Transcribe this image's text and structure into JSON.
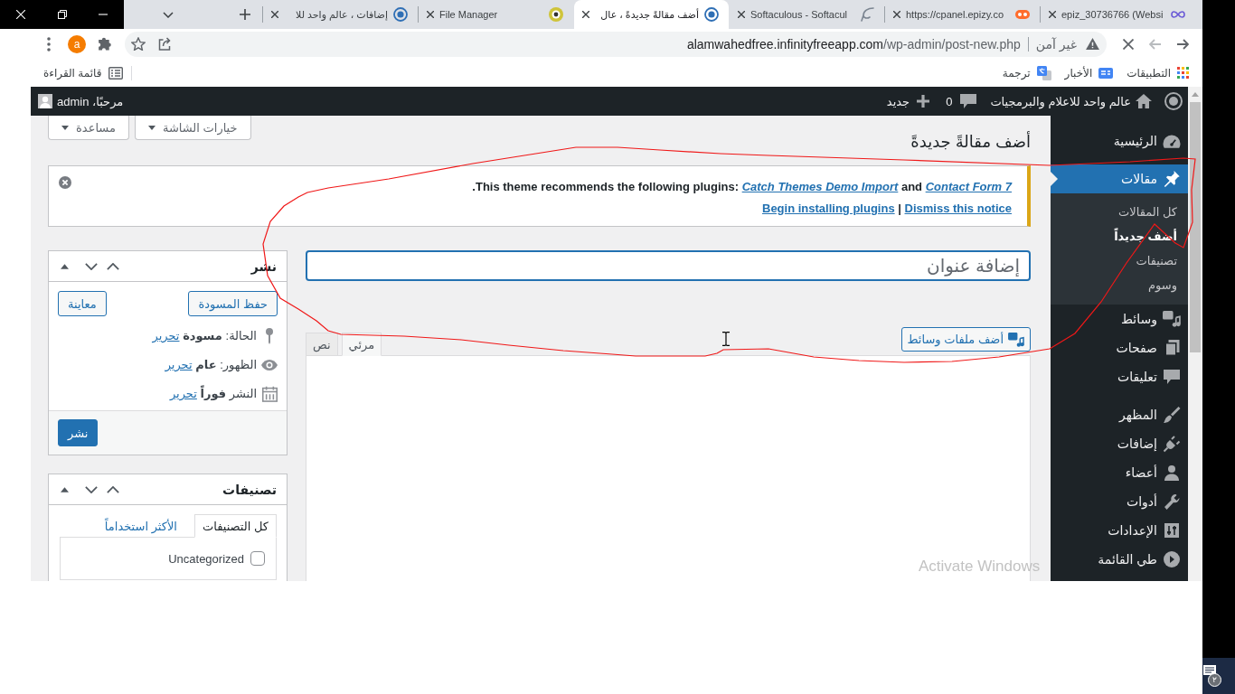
{
  "browser": {
    "tabs": [
      {
        "title": "epiz_30736766 (Websi",
        "selected": false
      },
      {
        "title": "https://cpanel.epizy.co",
        "selected": false
      },
      {
        "title": "Softaculous - Softacul",
        "selected": false
      },
      {
        "title": "أضف مقالةً جديدةً ، عال",
        "selected": true
      },
      {
        "title": "File Manager",
        "selected": false
      },
      {
        "title": "إضافات ، عالم واحد للا",
        "selected": false
      }
    ],
    "address_bar": {
      "security_label": "غير آمن",
      "url_host": "alamwahedfree.infinityfreeapp.com",
      "url_path": "/wp-admin/post-new.php"
    },
    "profile_initial": "a",
    "bookmarks": [
      {
        "label": "التطبيقات"
      },
      {
        "label": "الأخبار"
      },
      {
        "label": "ترجمة"
      }
    ],
    "reading_list": "قائمة القراءة"
  },
  "admin_bar": {
    "site_name": "عالم واحد للاعلام والبرمجيات",
    "comment_count": "0",
    "new_label": "جديد",
    "greeting": "مرحبًا، admin"
  },
  "admin_menu": [
    {
      "items": [
        {
          "label": "الرئيسية",
          "selected": false
        }
      ]
    },
    {
      "items": [
        {
          "label": "مقالات",
          "selected": true,
          "children": [
            {
              "label": "كل المقالات",
              "selected": false
            },
            {
              "label": "أضف جديداً",
              "selected": true
            },
            {
              "label": "تصنيفات",
              "selected": false
            },
            {
              "label": "وسوم",
              "selected": false
            }
          ]
        },
        {
          "label": "وسائط",
          "selected": false
        },
        {
          "label": "صفحات",
          "selected": false
        },
        {
          "label": "تعليقات",
          "selected": false
        }
      ]
    },
    {
      "items": [
        {
          "label": "المظهر",
          "selected": false
        },
        {
          "label": "إضافات",
          "selected": false
        },
        {
          "label": "أعضاء",
          "selected": false
        },
        {
          "label": "أدوات",
          "selected": false
        },
        {
          "label": "الإعدادات",
          "selected": false
        },
        {
          "label": "طي القائمة",
          "selected": false
        }
      ]
    }
  ],
  "screen_meta": [
    {
      "label": "خيارات الشاشة"
    },
    {
      "label": "مساعدة"
    }
  ],
  "page_title": "أضف مقالةً جديدةً",
  "notice": {
    "intro": "This theme recommends the following plugins:",
    "first_plugin": "Catch Themes Demo Import",
    "conjunction": "and",
    "second_plugin": "Contact Form 7",
    "end_mark": ".",
    "install_link": "Begin installing plugins",
    "separator": "|",
    "dismiss_link": "Dismiss this notice",
    "dismissible": true
  },
  "title_field": {
    "placeholder": "إضافة عنوان",
    "focused": true
  },
  "media_button": "أضف ملفات وسائط",
  "editor_tabs": [
    {
      "label": "مرئي",
      "selected": true
    },
    {
      "label": "نص",
      "selected": false
    }
  ],
  "publish_box": {
    "title": "نشر",
    "save_draft": "حفظ المسودة",
    "preview": "معاينة",
    "rows": [
      {
        "label": "الحالة:",
        "value": "مسودة",
        "link": "تحرير"
      },
      {
        "label": "الظهور:",
        "value": "عام",
        "link": "تحرير"
      },
      {
        "label": "النشر",
        "value": "فوراً",
        "link": "تحرير"
      }
    ],
    "publish_button": "نشر"
  },
  "categories_box": {
    "title": "تصنيفات",
    "tabs": [
      {
        "label": "كل التصنيفات",
        "selected": true
      },
      {
        "label": "الأكثر استخداماً",
        "selected": false
      }
    ],
    "items": [
      {
        "label": "Uncategorized",
        "checked": false
      }
    ]
  },
  "os_overlay": {
    "activation_text": "Activate Windows",
    "notification_badge": "٢"
  }
}
